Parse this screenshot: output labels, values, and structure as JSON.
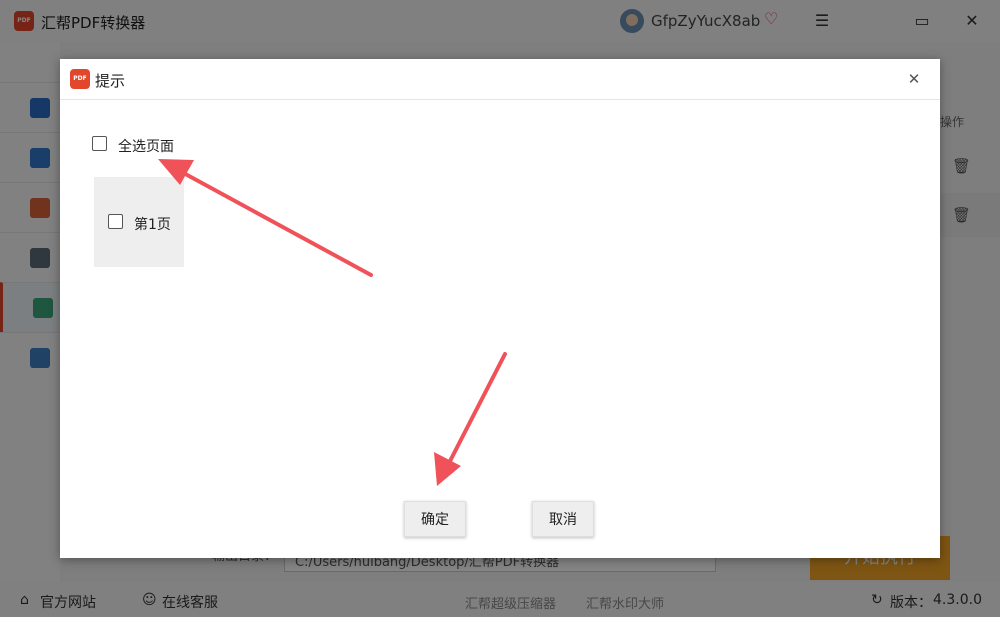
{
  "app": {
    "title": "汇帮PDF转换器",
    "logo_text": "PDF",
    "user_name": "GfpZyYucX8ab",
    "vip_icon": "♡",
    "menu_icon": "☰",
    "maximize_icon": "▭",
    "close_icon": "✕"
  },
  "table": {
    "op_header": "操作",
    "trash_icon": "🗑"
  },
  "output": {
    "label": "输出目录：",
    "path": "C:/Users/huibang/Desktop/汇帮PDF转换器",
    "start_label": "开始执行"
  },
  "statusbar": {
    "website": "官方网站",
    "support": "在线客服",
    "compressor": "汇帮超级压缩器",
    "watermark": "汇帮水印大师",
    "version_label": "版本：",
    "version": "4.3.0.0"
  },
  "dialog": {
    "title": "提示",
    "close_icon": "✕",
    "select_all_label": "全选页面",
    "pages": [
      {
        "label": "第1页"
      }
    ],
    "ok_label": "确定",
    "cancel_label": "取消"
  },
  "colors": {
    "brand": "#e2462b",
    "start_button": "#f2a325",
    "arrow": "#f0525a"
  }
}
